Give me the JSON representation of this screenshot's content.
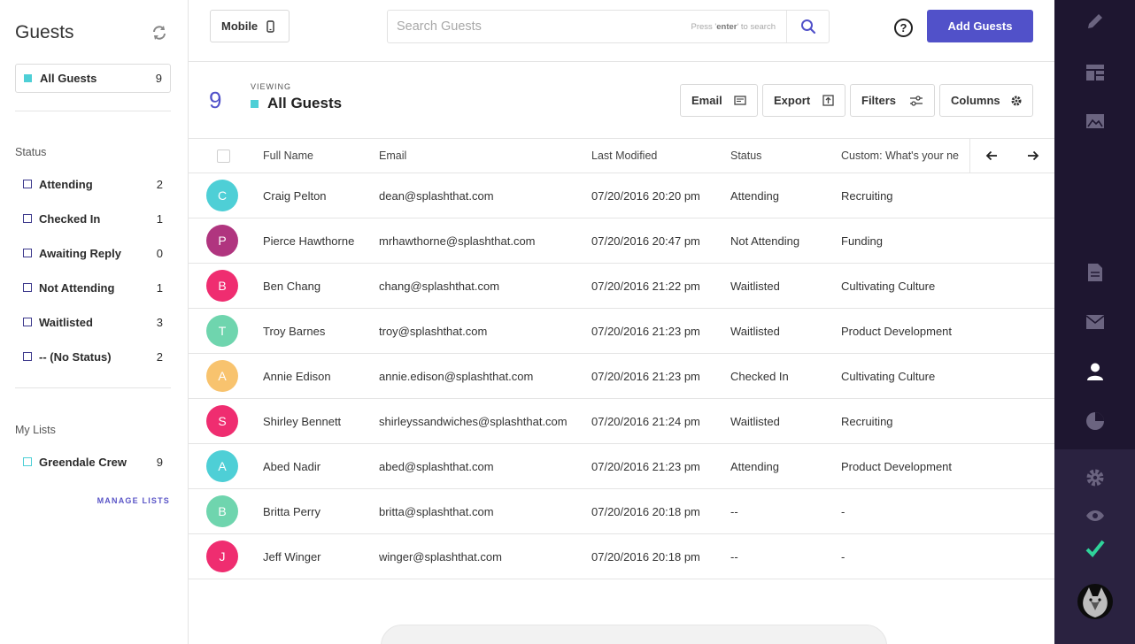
{
  "sidebar": {
    "title": "Guests",
    "all_guests": {
      "label": "All Guests",
      "count": "9"
    },
    "status_title": "Status",
    "statuses": [
      {
        "label": "Attending",
        "count": "2"
      },
      {
        "label": "Checked In",
        "count": "1"
      },
      {
        "label": "Awaiting Reply",
        "count": "0"
      },
      {
        "label": "Not Attending",
        "count": "1"
      },
      {
        "label": "Waitlisted",
        "count": "3"
      },
      {
        "label": "-- (No Status)",
        "count": "2"
      }
    ],
    "lists_title": "My Lists",
    "lists": [
      {
        "label": "Greendale Crew",
        "count": "9"
      }
    ],
    "manage_label": "MANAGE LISTS"
  },
  "topbar": {
    "mobile_label": "Mobile",
    "search_placeholder": "Search Guests",
    "search_hint_pre": "Press '",
    "search_hint_key": "enter",
    "search_hint_post": "' to search",
    "help_label": "?",
    "add_label": "Add Guests"
  },
  "view": {
    "count": "9",
    "viewing_label": "VIEWING",
    "name": "All Guests",
    "email_label": "Email",
    "export_label": "Export",
    "filters_label": "Filters",
    "columns_label": "Columns"
  },
  "table": {
    "columns": [
      "Full Name",
      "Email",
      "Last Modified",
      "Status",
      "Custom: What's your ne"
    ],
    "rows": [
      {
        "initial": "C",
        "color": "#4ecfd6",
        "name": "Craig Pelton",
        "email": "dean@splashthat.com",
        "modified": "07/20/2016 20:20 pm",
        "status": "Attending",
        "custom": "Recruiting"
      },
      {
        "initial": "P",
        "color": "#b0357f",
        "name": "Pierce Hawthorne",
        "email": "mrhawthorne@splashthat.com",
        "modified": "07/20/2016 20:47 pm",
        "status": "Not Attending",
        "custom": "Funding"
      },
      {
        "initial": "B",
        "color": "#ef2d70",
        "name": "Ben Chang",
        "email": "chang@splashthat.com",
        "modified": "07/20/2016 21:22 pm",
        "status": "Waitlisted",
        "custom": "Cultivating Culture"
      },
      {
        "initial": "T",
        "color": "#6fd5ae",
        "name": "Troy Barnes",
        "email": "troy@splashthat.com",
        "modified": "07/20/2016 21:23 pm",
        "status": "Waitlisted",
        "custom": "Product Development"
      },
      {
        "initial": "A",
        "color": "#f8c36e",
        "name": "Annie Edison",
        "email": "annie.edison@splashthat.com",
        "modified": "07/20/2016 21:23 pm",
        "status": "Checked In",
        "custom": "Cultivating Culture"
      },
      {
        "initial": "S",
        "color": "#ef2d70",
        "name": "Shirley Bennett",
        "email": "shirleyssandwiches@splashthat.com",
        "modified": "07/20/2016 21:24 pm",
        "status": "Waitlisted",
        "custom": "Recruiting"
      },
      {
        "initial": "A",
        "color": "#4ecfd6",
        "name": "Abed Nadir",
        "email": "abed@splashthat.com",
        "modified": "07/20/2016 21:23 pm",
        "status": "Attending",
        "custom": "Product Development"
      },
      {
        "initial": "B",
        "color": "#6fd5ae",
        "name": "Britta Perry",
        "email": "britta@splashthat.com",
        "modified": "07/20/2016 20:18 pm",
        "status": "--",
        "custom": "-"
      },
      {
        "initial": "J",
        "color": "#ef2d70",
        "name": "Jeff Winger",
        "email": "winger@splashthat.com",
        "modified": "07/20/2016 20:18 pm",
        "status": "--",
        "custom": "-"
      }
    ]
  },
  "rail_icons": [
    "pencil-icon",
    "layout-icon",
    "image-icon",
    "document-icon",
    "mail-icon",
    "person-icon",
    "pie-chart-icon",
    "gear-icon",
    "eye-icon",
    "check-icon"
  ],
  "colors": {
    "accent": "#5151c9",
    "teal": "#4ecfd6",
    "rail": "#1e1630",
    "check": "#2fd39a"
  }
}
